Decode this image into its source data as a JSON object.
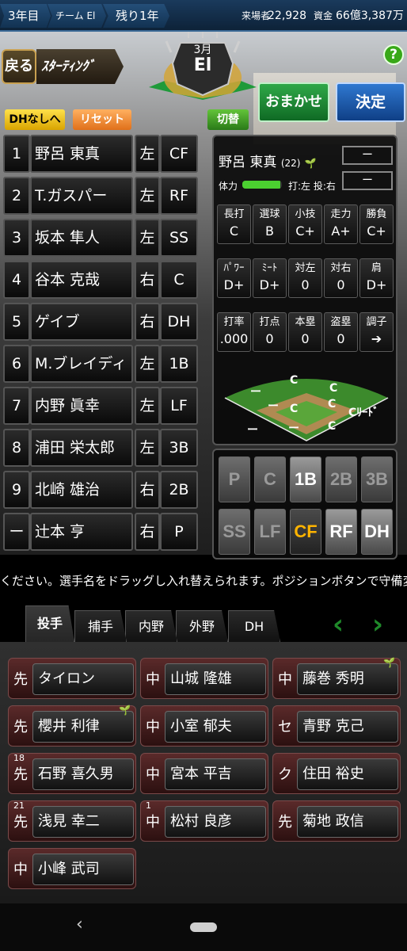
{
  "status": {
    "year": "3年目",
    "team": "チーム El",
    "remaining": "残り1年",
    "attendance_label": "来場者",
    "attendance": "22,928",
    "funds_label": "資金",
    "funds": "66億3,387万"
  },
  "header": {
    "back": "戻る",
    "title": "ｽﾀｰﾃｨﾝｸﾞ",
    "month": "3月",
    "team_short": "El",
    "help": "?",
    "omakase": "おまかせ",
    "decide": "決定",
    "dh_toggle": "DHなしへ",
    "reset": "リセット",
    "switch": "切替"
  },
  "lineup": [
    {
      "order": "1",
      "name": "野呂 東真",
      "hand": "左",
      "pos": "CF"
    },
    {
      "order": "2",
      "name": "T.ガスパー",
      "hand": "左",
      "pos": "RF"
    },
    {
      "order": "3",
      "name": "坂本 隼人",
      "hand": "左",
      "pos": "SS"
    },
    {
      "order": "4",
      "name": "谷本 克哉",
      "hand": "右",
      "pos": "C"
    },
    {
      "order": "5",
      "name": "ゲイブ",
      "hand": "右",
      "pos": "DH"
    },
    {
      "order": "6",
      "name": "M.ブレイディ",
      "hand": "左",
      "pos": "1B"
    },
    {
      "order": "7",
      "name": "内野 眞幸",
      "hand": "左",
      "pos": "LF"
    },
    {
      "order": "8",
      "name": "浦田 栄太郎",
      "hand": "左",
      "pos": "3B"
    },
    {
      "order": "9",
      "name": "北崎 雄治",
      "hand": "右",
      "pos": "2B"
    },
    {
      "order": "ー",
      "name": "辻本 亨",
      "hand": "右",
      "pos": "P"
    }
  ],
  "player": {
    "name": "野呂 東真",
    "age": "(22)",
    "box1": "ー",
    "box2": "ー",
    "stamina_label": "体力",
    "stamina_level": 0.95,
    "bat_throw": "打:左 投:右",
    "stats": [
      {
        "label": "長打",
        "value": "C"
      },
      {
        "label": "選球",
        "value": "B"
      },
      {
        "label": "小技",
        "value": "C+"
      },
      {
        "label": "走力",
        "value": "A+"
      },
      {
        "label": "勝負",
        "value": "C+"
      },
      {
        "label": "ﾊﾟﾜｰ",
        "value": "D+"
      },
      {
        "label": "ﾐｰﾄ",
        "value": "D+"
      },
      {
        "label": "対左",
        "value": "0"
      },
      {
        "label": "対右",
        "value": "0"
      },
      {
        "label": "肩",
        "value": "D+"
      },
      {
        "label": "打率",
        "value": ".000"
      },
      {
        "label": "打点",
        "value": "0"
      },
      {
        "label": "本塁",
        "value": "0"
      },
      {
        "label": "盗塁",
        "value": "0"
      },
      {
        "label": "調子",
        "value": "➔"
      }
    ],
    "field": {
      "lf": "ー",
      "cf": "C",
      "rf": "C",
      "ss": "ー",
      "b2": "C",
      "b3": "ー",
      "b1": "ー",
      "c": "ー",
      "p": "C",
      "lead_label": "Cﾘｰﾄﾞ",
      "bottom_left": "ー",
      "bottom_right": "C"
    }
  },
  "positions": [
    {
      "label": "P",
      "state": "off"
    },
    {
      "label": "C",
      "state": "off"
    },
    {
      "label": "1B",
      "state": "on"
    },
    {
      "label": "2B",
      "state": "off"
    },
    {
      "label": "3B",
      "state": "off"
    },
    {
      "label": "SS",
      "state": "off"
    },
    {
      "label": "LF",
      "state": "off"
    },
    {
      "label": "CF",
      "state": "sel"
    },
    {
      "label": "RF",
      "state": "on"
    },
    {
      "label": "DH",
      "state": "on"
    }
  ],
  "instruction": "ください。選手名をドラッグし入れ替えられます。ポジションボタンで守備変",
  "tabs": [
    "投手",
    "捕手",
    "内野",
    "外野",
    "DH"
  ],
  "bench": [
    {
      "role": "先",
      "name": "タイロン",
      "num": "",
      "sprout": false
    },
    {
      "role": "中",
      "name": "山城 隆雄",
      "num": "",
      "sprout": false
    },
    {
      "role": "中",
      "name": "藤巻 秀明",
      "num": "",
      "sprout": true
    },
    {
      "role": "先",
      "name": "櫻井 利律",
      "num": "",
      "sprout": true
    },
    {
      "role": "中",
      "name": "小室 郁夫",
      "num": "",
      "sprout": false
    },
    {
      "role": "セ",
      "name": "青野 克己",
      "num": "",
      "sprout": false
    },
    {
      "role": "先",
      "name": "石野 喜久男",
      "num": "18",
      "sprout": false
    },
    {
      "role": "中",
      "name": "宮本 平吉",
      "num": "",
      "sprout": false
    },
    {
      "role": "ク",
      "name": "住田 裕史",
      "num": "",
      "sprout": false
    },
    {
      "role": "先",
      "name": "浅見 幸二",
      "num": "21",
      "sprout": false
    },
    {
      "role": "中",
      "name": "松村 良彦",
      "num": "1",
      "sprout": false
    },
    {
      "role": "先",
      "name": "菊地 政信",
      "num": "",
      "sprout": false
    },
    {
      "role": "中",
      "name": "小峰 武司",
      "num": "",
      "sprout": false
    }
  ]
}
